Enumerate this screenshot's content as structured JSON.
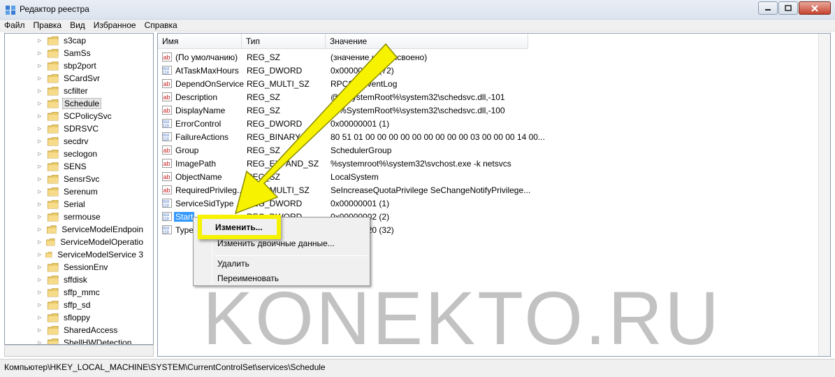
{
  "window": {
    "title": "Редактор реестра",
    "buttons": [
      "minimize",
      "maximize",
      "close"
    ]
  },
  "menu": [
    "Файл",
    "Правка",
    "Вид",
    "Избранное",
    "Справка"
  ],
  "tree": {
    "items": [
      {
        "label": "s3cap"
      },
      {
        "label": "SamSs"
      },
      {
        "label": "sbp2port"
      },
      {
        "label": "SCardSvr"
      },
      {
        "label": "scfilter"
      },
      {
        "label": "Schedule",
        "selected": true
      },
      {
        "label": "SCPolicySvc"
      },
      {
        "label": "SDRSVC"
      },
      {
        "label": "secdrv"
      },
      {
        "label": "seclogon"
      },
      {
        "label": "SENS"
      },
      {
        "label": "SensrSvc"
      },
      {
        "label": "Serenum"
      },
      {
        "label": "Serial"
      },
      {
        "label": "sermouse"
      },
      {
        "label": "ServiceModelEndpoin"
      },
      {
        "label": "ServiceModelOperatio"
      },
      {
        "label": "ServiceModelService 3"
      },
      {
        "label": "SessionEnv"
      },
      {
        "label": "sffdisk"
      },
      {
        "label": "sffp_mmc"
      },
      {
        "label": "sffp_sd"
      },
      {
        "label": "sfloppy"
      },
      {
        "label": "SharedAccess"
      },
      {
        "label": "ShellHWDetection"
      }
    ]
  },
  "list": {
    "headers": {
      "name": "Имя",
      "type": "Тип",
      "data": "Значение"
    },
    "rows": [
      {
        "icon": "string-value-icon",
        "name": "(По умолчанию)",
        "type": "REG_SZ",
        "data": "(значение не присвоено)"
      },
      {
        "icon": "binary-value-icon",
        "name": "AtTaskMaxHours",
        "type": "REG_DWORD",
        "data": "0x00000048 (72)"
      },
      {
        "icon": "string-value-icon",
        "name": "DependOnService",
        "type": "REG_MULTI_SZ",
        "data": "RPCSS EventLog"
      },
      {
        "icon": "string-value-icon",
        "name": "Description",
        "type": "REG_SZ",
        "data": "@%SystemRoot%\\system32\\schedsvc.dll,-101"
      },
      {
        "icon": "string-value-icon",
        "name": "DisplayName",
        "type": "REG_SZ",
        "data": "@%SystemRoot%\\system32\\schedsvc.dll,-100"
      },
      {
        "icon": "binary-value-icon",
        "name": "ErrorControl",
        "type": "REG_DWORD",
        "data": "0x00000001 (1)"
      },
      {
        "icon": "binary-value-icon",
        "name": "FailureActions",
        "type": "REG_BINARY",
        "data": "80 51 01 00 00 00 00 00 00 00 00 00 03 00 00 00 14 00..."
      },
      {
        "icon": "string-value-icon",
        "name": "Group",
        "type": "REG_SZ",
        "data": "SchedulerGroup"
      },
      {
        "icon": "string-value-icon",
        "name": "ImagePath",
        "type": "REG_EXPAND_SZ",
        "data": "%systemroot%\\system32\\svchost.exe -k netsvcs"
      },
      {
        "icon": "string-value-icon",
        "name": "ObjectName",
        "type": "REG_SZ",
        "data": "LocalSystem"
      },
      {
        "icon": "string-value-icon",
        "name": "RequiredPrivileg...",
        "type": "REG_MULTI_SZ",
        "data": "SeIncreaseQuotaPrivilege SeChangeNotifyPrivilege..."
      },
      {
        "icon": "binary-value-icon",
        "name": "ServiceSidType",
        "type": "REG_DWORD",
        "data": "0x00000001 (1)"
      },
      {
        "icon": "binary-value-icon",
        "name": "Start",
        "type": "REG_DWORD",
        "data": "0x00000002 (2)",
        "selected": true
      },
      {
        "icon": "binary-value-icon",
        "name": "Type",
        "type": "REG_DWORD",
        "data": "0x00000020 (32)"
      }
    ]
  },
  "context_menu": {
    "items": [
      "Изменить...",
      "Изменить двоичные данные...",
      "Удалить",
      "Переименовать"
    ]
  },
  "status_path": "Компьютер\\HKEY_LOCAL_MACHINE\\SYSTEM\\CurrentControlSet\\services\\Schedule",
  "watermark": "KONEKTO.RU",
  "colors": {
    "highlight": "#f6f200",
    "selection": "#3399ff",
    "arrow": "#f6f200"
  }
}
